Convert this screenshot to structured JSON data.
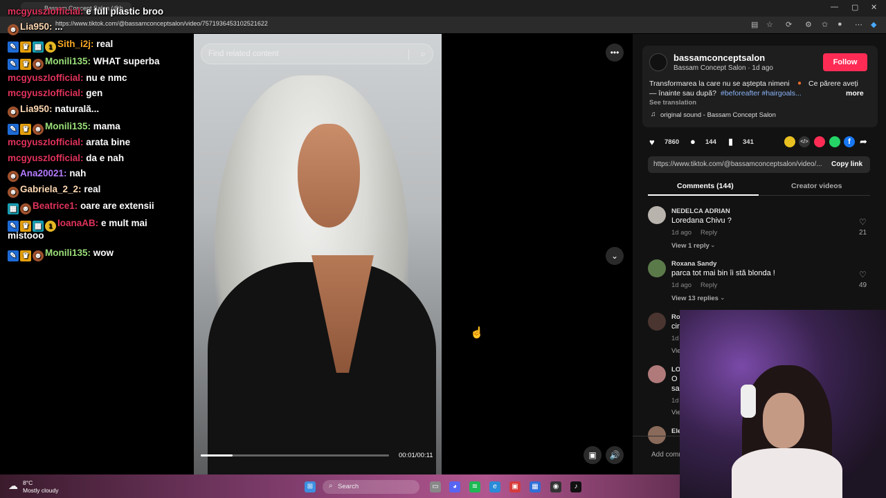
{
  "browser": {
    "tab_title": "Bassam Concept Salon (@b",
    "url": "https://www.tiktok.com/@bassamconceptsalon/video/7571936453102521622"
  },
  "chat": [
    {
      "user": "mcgyuszIofficial:",
      "text": "e full plastic broo",
      "color": "#e0325a",
      "badges": []
    },
    {
      "user": "Lia950:",
      "text": "...",
      "color": "#ffd9b3",
      "badges": [
        "face"
      ]
    },
    {
      "user": "Sith_i2j:",
      "text": "real",
      "color": "#f5a623",
      "badges": [
        "mod",
        "crown",
        "blue",
        "coin"
      ]
    },
    {
      "user": "Monili135:",
      "text": "WHAT superba",
      "color": "#9be07a",
      "badges": [
        "mod",
        "crown",
        "face"
      ]
    },
    {
      "user": "mcgyuszIofficial:",
      "text": "nu e nmc",
      "color": "#e0325a",
      "badges": []
    },
    {
      "user": "mcgyuszIofficial:",
      "text": "gen",
      "color": "#e0325a",
      "badges": []
    },
    {
      "user": "Lia950:",
      "text": "naturală...",
      "color": "#ffd9b3",
      "badges": [
        "face"
      ]
    },
    {
      "user": "Monili135:",
      "text": "mama",
      "color": "#9be07a",
      "badges": [
        "mod",
        "crown",
        "face"
      ]
    },
    {
      "user": "mcgyuszIofficial:",
      "text": "arata bine",
      "color": "#e0325a",
      "badges": []
    },
    {
      "user": "mcgyuszIofficial:",
      "text": "da e nah",
      "color": "#e0325a",
      "badges": []
    },
    {
      "user": "Ana20021:",
      "text": "nah",
      "color": "#b57cff",
      "badges": [
        "face"
      ]
    },
    {
      "user": "Gabriela_2_2:",
      "text": "real",
      "color": "#ffd9b3",
      "badges": [
        "face"
      ]
    },
    {
      "user": "Beatrice1:",
      "text": "oare are extensii",
      "color": "#e0325a",
      "badges": [
        "blue",
        "face"
      ]
    },
    {
      "user": "IoanaAB:",
      "text": "e mult mai",
      "text2": "mistooo",
      "color": "#e0325a",
      "badges": [
        "mod",
        "crown",
        "blue",
        "coin"
      ]
    },
    {
      "user": "Monili135:",
      "text": "wow",
      "color": "#9be07a",
      "badges": [
        "mod",
        "crown",
        "face"
      ]
    }
  ],
  "video": {
    "search_placeholder": "Find related content",
    "time": "00:01/00:11",
    "progress": 0.17
  },
  "author": {
    "handle": "bassamconceptsalon",
    "subline": "Bassam Concept Salon · 1d ago",
    "follow_label": "Follow",
    "caption_line1": "Transformarea la care nu se aștepta nimeni",
    "caption_line1b": "Ce părere aveți",
    "caption_line2": "— înainte sau după?",
    "hashtags": "#beforeafter #hairgoals...",
    "more": "more",
    "see_translation": "See translation",
    "sound": "original sound - Bassam Concept Salon"
  },
  "stats": {
    "likes": "7860",
    "comments": "144",
    "saves": "341"
  },
  "share": {
    "link": "https://www.tiktok.com/@bassamconceptsalon/video/...",
    "copy_label": "Copy link"
  },
  "tabs": {
    "comments": "Comments (144)",
    "creator": "Creator videos"
  },
  "comments": [
    {
      "name": "NEDELCA ADRIAN",
      "text": "Loredana Chivu ?",
      "time": "1d ago",
      "reply": "Reply",
      "likes": "21",
      "view": "View 1 reply"
    },
    {
      "name": "Roxana Sandy",
      "text": "parca tot mai bin îi stă blonda !",
      "time": "1d ago",
      "reply": "Reply",
      "likes": "49",
      "view": "View 13 replies"
    }
  ],
  "partial": {
    "r1": "Ro",
    "r2": "cir",
    "r3": "1d",
    "r4": "Vie",
    "l1": "LO",
    "l2": "O",
    "l3": "sa",
    "l4": "1d",
    "l5": "Vie",
    "e1": "Ele",
    "add_comment": "Add comm"
  },
  "taskbar": {
    "temp": "8°C",
    "weather": "Mostly cloudy",
    "search": "Search"
  }
}
